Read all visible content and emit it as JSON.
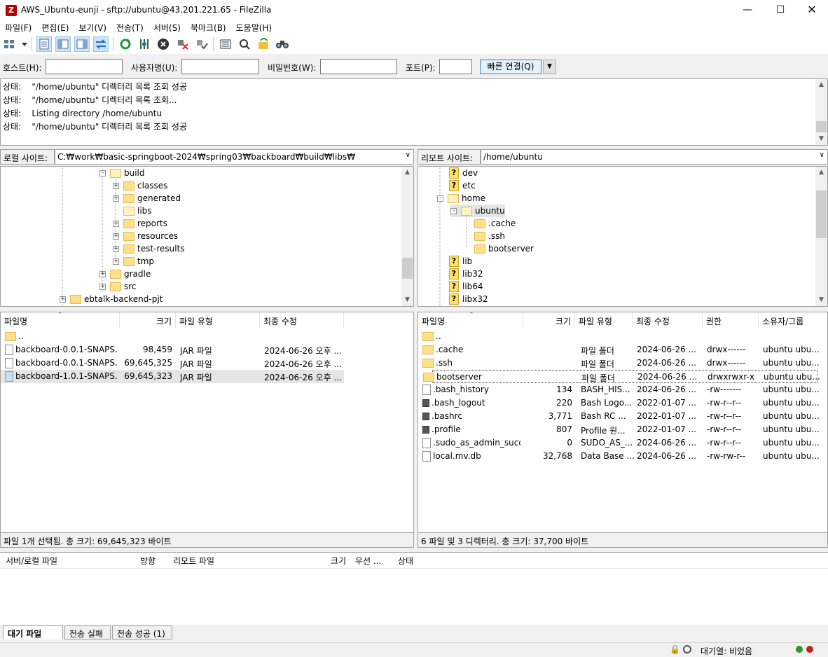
{
  "window": {
    "title": "AWS_Ubuntu-eunji - sftp://ubuntu@43.201.221.65 - FileZilla",
    "app_icon_letter": "Z"
  },
  "menu": [
    "파일(F)",
    "편집(E)",
    "보기(V)",
    "전송(T)",
    "서버(S)",
    "북마크(B)",
    "도움말(H)"
  ],
  "quickconnect": {
    "host_label": "호스트(H):",
    "user_label": "사용자명(U):",
    "pass_label": "비밀번호(W):",
    "port_label": "포트(P):",
    "host_value": "",
    "user_value": "",
    "pass_value": "",
    "port_value": "",
    "connect_button": "빠른 연결(Q)"
  },
  "log": [
    {
      "prefix": "상태:",
      "text": "\"/home/ubuntu\" 디렉터리 목록 조회 성공"
    },
    {
      "prefix": "상태:",
      "text": "\"/home/ubuntu\" 디렉터리 목록 조회..."
    },
    {
      "prefix": "상태:",
      "text": "Listing directory /home/ubuntu"
    },
    {
      "prefix": "상태:",
      "text": "\"/home/ubuntu\" 디렉터리 목록 조회 성공"
    }
  ],
  "local": {
    "site_label": "로컬 사이트:",
    "path": "C:₩work₩basic-springboot-2024₩spring03₩backboard₩build₩libs₩",
    "tree": [
      "build",
      "classes",
      "generated",
      "libs",
      "reports",
      "resources",
      "test-results",
      "tmp",
      "gradle",
      "src",
      "ebtalk-backend-pjt"
    ],
    "columns": [
      "파일명",
      "크기",
      "파일 유형",
      "최종 수정"
    ],
    "files": [
      {
        "name": "..",
        "size": "",
        "type": "",
        "modified": ""
      },
      {
        "name": "backboard-0.0.1-SNAPS...",
        "size": "98,459",
        "type": "JAR 파일",
        "modified": "2024-06-26 오후 ..."
      },
      {
        "name": "backboard-0.0.1-SNAPS...",
        "size": "69,645,325",
        "type": "JAR 파일",
        "modified": "2024-06-26 오후 ..."
      },
      {
        "name": "backboard-1.0.1-SNAPS...",
        "size": "69,645,323",
        "type": "JAR 파일",
        "modified": "2024-06-26 오후 ..."
      }
    ],
    "status": "파일 1개 선택됨. 총 크기: 69,645,323 바이트"
  },
  "remote": {
    "site_label": "리모트 사이트:",
    "path": "/home/ubuntu",
    "tree": [
      "dev",
      "etc",
      "home",
      "ubuntu",
      ".cache",
      ".ssh",
      "bootserver",
      "lib",
      "lib32",
      "lib64",
      "libx32"
    ],
    "columns": [
      "파일명",
      "크기",
      "파일 유형",
      "최종 수정",
      "권한",
      "소유자/그룹"
    ],
    "files": [
      {
        "name": "..",
        "size": "",
        "type": "",
        "modified": "",
        "perm": "",
        "owner": ""
      },
      {
        "name": ".cache",
        "size": "",
        "type": "파일 폴더",
        "modified": "2024-06-26 ...",
        "perm": "drwx------",
        "owner": "ubuntu ubu..."
      },
      {
        "name": ".ssh",
        "size": "",
        "type": "파일 폴더",
        "modified": "2024-06-26 ...",
        "perm": "drwx------",
        "owner": "ubuntu ubu..."
      },
      {
        "name": "bootserver",
        "size": "",
        "type": "파일 폴더",
        "modified": "2024-06-26 ...",
        "perm": "drwxrwxr-x",
        "owner": "ubuntu ubu..."
      },
      {
        "name": ".bash_history",
        "size": "134",
        "type": "BASH_HIS...",
        "modified": "2024-06-26 ...",
        "perm": "-rw-------",
        "owner": "ubuntu ubu..."
      },
      {
        "name": ".bash_logout",
        "size": "220",
        "type": "Bash Logo...",
        "modified": "2022-01-07 ...",
        "perm": "-rw-r--r--",
        "owner": "ubuntu ubu..."
      },
      {
        "name": ".bashrc",
        "size": "3,771",
        "type": "Bash RC ...",
        "modified": "2022-01-07 ...",
        "perm": "-rw-r--r--",
        "owner": "ubuntu ubu..."
      },
      {
        "name": ".profile",
        "size": "807",
        "type": "Profile 원...",
        "modified": "2022-01-07 ...",
        "perm": "-rw-r--r--",
        "owner": "ubuntu ubu..."
      },
      {
        "name": ".sudo_as_admin_succ...",
        "size": "0",
        "type": "SUDO_AS_...",
        "modified": "2024-06-26 ...",
        "perm": "-rw-r--r--",
        "owner": "ubuntu ubu..."
      },
      {
        "name": "local.mv.db",
        "size": "32,768",
        "type": "Data Base ...",
        "modified": "2024-06-26 ...",
        "perm": "-rw-rw-r--",
        "owner": "ubuntu ubu..."
      }
    ],
    "status": "6 파일 및 3 디렉터리. 총 크기: 37,700 바이트"
  },
  "queue": {
    "columns": [
      "서버/로컬 파일",
      "방향",
      "리모트 파일",
      "크기",
      "우선 ...",
      "상태"
    ],
    "tabs": [
      "대기 파일",
      "전송 실패",
      "전송 성공 (1)"
    ]
  },
  "statusbar": {
    "queue_text": "대기열: 비었음"
  }
}
